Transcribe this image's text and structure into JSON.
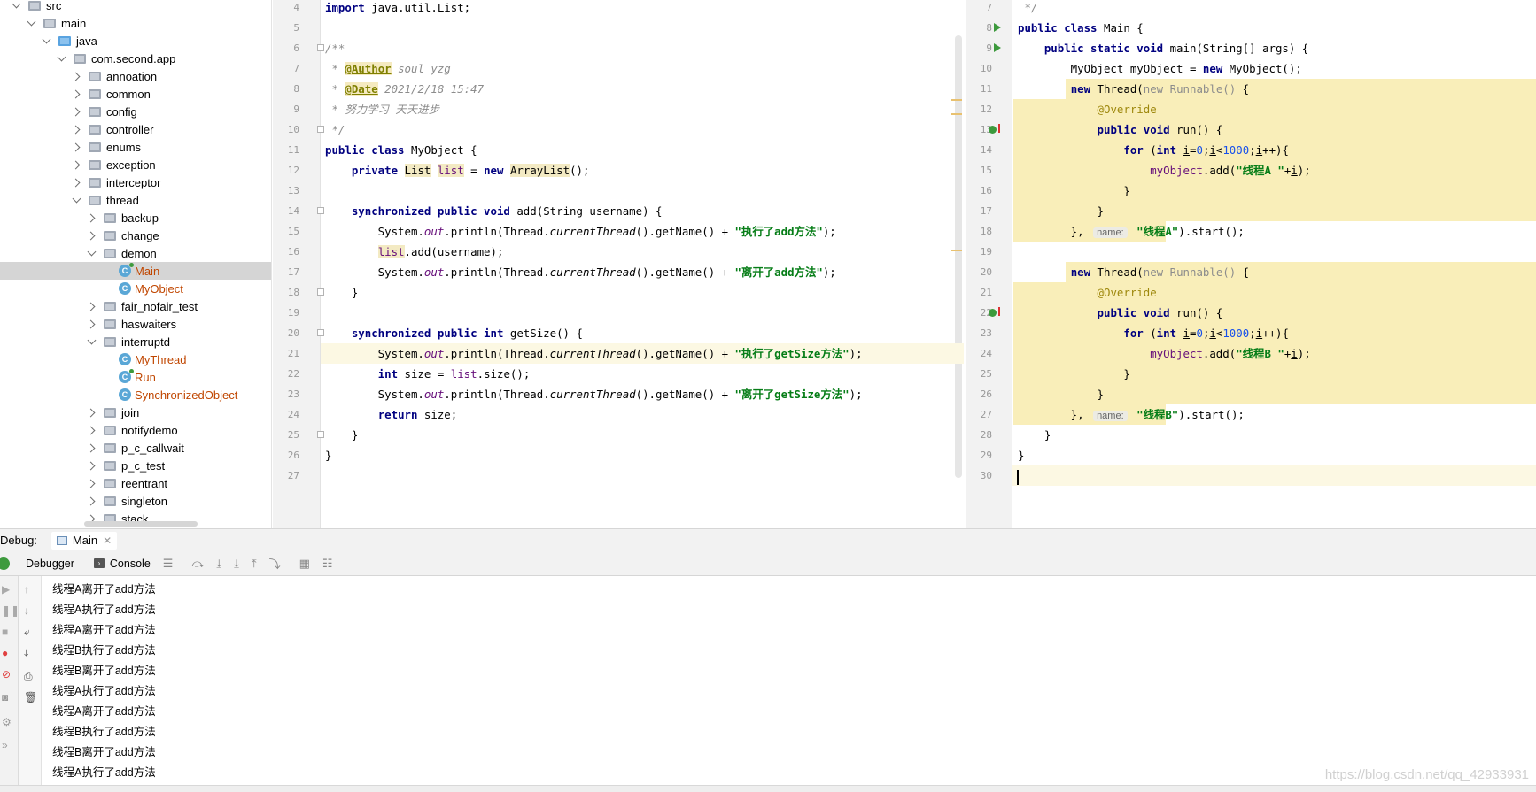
{
  "tree": {
    "items": [
      {
        "label": "src",
        "indent": 0,
        "type": "folder",
        "open": true
      },
      {
        "label": "main",
        "indent": 1,
        "type": "folder",
        "open": true
      },
      {
        "label": "java",
        "indent": 2,
        "type": "folder-blue",
        "open": true
      },
      {
        "label": "com.second.app",
        "indent": 3,
        "type": "folder",
        "open": true
      },
      {
        "label": "annoation",
        "indent": 4,
        "type": "folder",
        "open": false
      },
      {
        "label": "common",
        "indent": 4,
        "type": "folder",
        "open": false
      },
      {
        "label": "config",
        "indent": 4,
        "type": "folder",
        "open": false
      },
      {
        "label": "controller",
        "indent": 4,
        "type": "folder",
        "open": false
      },
      {
        "label": "enums",
        "indent": 4,
        "type": "folder",
        "open": false
      },
      {
        "label": "exception",
        "indent": 4,
        "type": "folder",
        "open": false
      },
      {
        "label": "interceptor",
        "indent": 4,
        "type": "folder",
        "open": false
      },
      {
        "label": "thread",
        "indent": 4,
        "type": "folder",
        "open": true
      },
      {
        "label": "backup",
        "indent": 5,
        "type": "folder",
        "open": false
      },
      {
        "label": "change",
        "indent": 5,
        "type": "folder",
        "open": false
      },
      {
        "label": "demon",
        "indent": 5,
        "type": "folder",
        "open": true
      },
      {
        "label": "Main",
        "indent": 6,
        "type": "class-run",
        "selected": true
      },
      {
        "label": "MyObject",
        "indent": 6,
        "type": "class"
      },
      {
        "label": "fair_nofair_test",
        "indent": 5,
        "type": "folder",
        "open": false
      },
      {
        "label": "haswaiters",
        "indent": 5,
        "type": "folder",
        "open": false
      },
      {
        "label": "interruptd",
        "indent": 5,
        "type": "folder",
        "open": true
      },
      {
        "label": "MyThread",
        "indent": 6,
        "type": "class"
      },
      {
        "label": "Run",
        "indent": 6,
        "type": "class-run"
      },
      {
        "label": "SynchronizedObject",
        "indent": 6,
        "type": "class"
      },
      {
        "label": "join",
        "indent": 5,
        "type": "folder",
        "open": false
      },
      {
        "label": "notifydemo",
        "indent": 5,
        "type": "folder",
        "open": false
      },
      {
        "label": "p_c_callwait",
        "indent": 5,
        "type": "folder",
        "open": false
      },
      {
        "label": "p_c_test",
        "indent": 5,
        "type": "folder",
        "open": false
      },
      {
        "label": "reentrant",
        "indent": 5,
        "type": "folder",
        "open": false
      },
      {
        "label": "singleton",
        "indent": 5,
        "type": "folder",
        "open": false
      },
      {
        "label": "stack",
        "indent": 5,
        "type": "folder",
        "open": false
      }
    ]
  },
  "editor_left": {
    "lines": [
      {
        "n": "4",
        "html": "<span class=\"kw\">import</span> java.util.List;"
      },
      {
        "n": "5",
        "html": ""
      },
      {
        "n": "6",
        "html": "<span class=\"cm\">/**</span>"
      },
      {
        "n": "7",
        "html": "<span class=\"cm\"> * </span><span class=\"tag\">@Author</span><span class=\"cm\"> soul yzg</span>"
      },
      {
        "n": "8",
        "html": "<span class=\"cm\"> * </span><span class=\"tag\">@Date</span><span class=\"cm\"> 2021/2/18 15:47</span>"
      },
      {
        "n": "9",
        "html": "<span class=\"cm\"> * 努力学习 天天进步</span>"
      },
      {
        "n": "10",
        "html": "<span class=\"cm\"> */</span>"
      },
      {
        "n": "11",
        "html": "<span class=\"kw\">public class</span> MyObject {"
      },
      {
        "n": "12",
        "html": "    <span class=\"kw\">private</span> <span class=\"hilite\">List</span> <span class=\"fld hilite\">list</span> = <span class=\"kw\">new</span> <span class=\"hilite\">ArrayList</span>();"
      },
      {
        "n": "13",
        "html": ""
      },
      {
        "n": "14",
        "html": "    <span class=\"kw\">synchronized public void</span> add(String username) {"
      },
      {
        "n": "15",
        "html": "        System.<span class=\"sfld\">out</span>.println(Thread.<span class=\"ital\">currentThread</span>().getName() + <span class=\"str\">\"执行了add方法\"</span>);"
      },
      {
        "n": "16",
        "html": "        <span class=\"fld hilite\">list</span>.add(username);"
      },
      {
        "n": "17",
        "html": "        System.<span class=\"sfld\">out</span>.println(Thread.<span class=\"ital\">currentThread</span>().getName() + <span class=\"str\">\"离开了add方法\"</span>);"
      },
      {
        "n": "18",
        "html": "    }"
      },
      {
        "n": "19",
        "html": ""
      },
      {
        "n": "20",
        "html": "    <span class=\"kw\">synchronized public int</span> getSize() {"
      },
      {
        "n": "21",
        "html": "        System.<span class=\"sfld\">out</span>.println(Thread.<span class=\"ital\">currentThread</span>().getName() + <span class=\"str\">\"执行了getSize方法\"</span>);",
        "current": true
      },
      {
        "n": "22",
        "html": "        <span class=\"kw\">int</span> size = <span class=\"fld\">list</span>.size();"
      },
      {
        "n": "23",
        "html": "        System.<span class=\"sfld\">out</span>.println(Thread.<span class=\"ital\">currentThread</span>().getName() + <span class=\"str\">\"离开了getSize方法\"</span>);"
      },
      {
        "n": "24",
        "html": "        <span class=\"kw\">return</span> size;"
      },
      {
        "n": "25",
        "html": "    }"
      },
      {
        "n": "26",
        "html": "}"
      },
      {
        "n": "27",
        "html": ""
      }
    ]
  },
  "editor_right": {
    "lines": [
      {
        "n": "7",
        "html": "<span class=\"cm\"> */</span>"
      },
      {
        "n": "8",
        "html": "<span class=\"kw\">public class</span> Main {",
        "run": true
      },
      {
        "n": "9",
        "html": "    <span class=\"kw\">public static void</span> main(String[] args) {",
        "run": true
      },
      {
        "n": "10",
        "html": "        MyObject myObject = <span class=\"kw\">new</span> MyObject();"
      },
      {
        "n": "11",
        "html": "        <span class=\"kw\">new</span> Thread(<span class=\"gray\">new Runnable() </span>{",
        "yellow": "partial"
      },
      {
        "n": "12",
        "html": "            <span class=\"ann\">@Override</span>",
        "yellow": "full"
      },
      {
        "n": "13",
        "html": "            <span class=\"kw\">public void</span> run() {",
        "yellow": "full",
        "override": true
      },
      {
        "n": "14",
        "html": "                <span class=\"kw\">for</span> (<span class=\"kw\">int</span> <span class=\"var\">i</span>=<span class=\"num\">0</span>;<span class=\"var\">i</span>&lt;<span class=\"num\">1000</span>;<span class=\"var\">i</span>++){",
        "yellow": "full"
      },
      {
        "n": "15",
        "html": "                    <span class=\"fld\">myObject</span>.add(<span class=\"str\">\"线程A \"</span>+<span class=\"var\">i</span>);",
        "yellow": "full"
      },
      {
        "n": "16",
        "html": "                }",
        "yellow": "full"
      },
      {
        "n": "17",
        "html": "            }",
        "yellow": "full"
      },
      {
        "n": "18",
        "html": "        }, <span class=\"hintbox\">name:</span> <span class=\"str\">\"线程A\"</span>).start();",
        "yellow": "end"
      },
      {
        "n": "19",
        "html": ""
      },
      {
        "n": "20",
        "html": "        <span class=\"kw\">new</span> Thread(<span class=\"gray\">new Runnable() </span>{",
        "yellow": "partial"
      },
      {
        "n": "21",
        "html": "            <span class=\"ann\">@Override</span>",
        "yellow": "full"
      },
      {
        "n": "22",
        "html": "            <span class=\"kw\">public void</span> run() {",
        "yellow": "full",
        "override": true
      },
      {
        "n": "23",
        "html": "                <span class=\"kw\">for</span> (<span class=\"kw\">int</span> <span class=\"var\">i</span>=<span class=\"num\">0</span>;<span class=\"var\">i</span>&lt;<span class=\"num\">1000</span>;<span class=\"var\">i</span>++){",
        "yellow": "full"
      },
      {
        "n": "24",
        "html": "                    <span class=\"fld\">myObject</span>.add(<span class=\"str\">\"线程B \"</span>+<span class=\"var\">i</span>);",
        "yellow": "full"
      },
      {
        "n": "25",
        "html": "                }",
        "yellow": "full"
      },
      {
        "n": "26",
        "html": "            }",
        "yellow": "full"
      },
      {
        "n": "27",
        "html": "        }, <span class=\"hintbox\">name:</span> <span class=\"str\">\"线程B\"</span>).start();",
        "yellow": "end"
      },
      {
        "n": "28",
        "html": "    }"
      },
      {
        "n": "29",
        "html": "}"
      },
      {
        "n": "30",
        "html": "",
        "current": true
      }
    ]
  },
  "debug": {
    "label": "Debug:",
    "tab_label": "Main",
    "debugger_tab": "Debugger",
    "console_tab": "Console",
    "console_lines": [
      "线程A离开了add方法",
      "线程A执行了add方法",
      "线程A离开了add方法",
      "线程B执行了add方法",
      "线程B离开了add方法",
      "线程A执行了add方法",
      "线程A离开了add方法",
      "线程B执行了add方法",
      "线程B离开了add方法",
      "线程A执行了add方法"
    ]
  },
  "watermark": "https://blog.csdn.net/qq_42933931"
}
